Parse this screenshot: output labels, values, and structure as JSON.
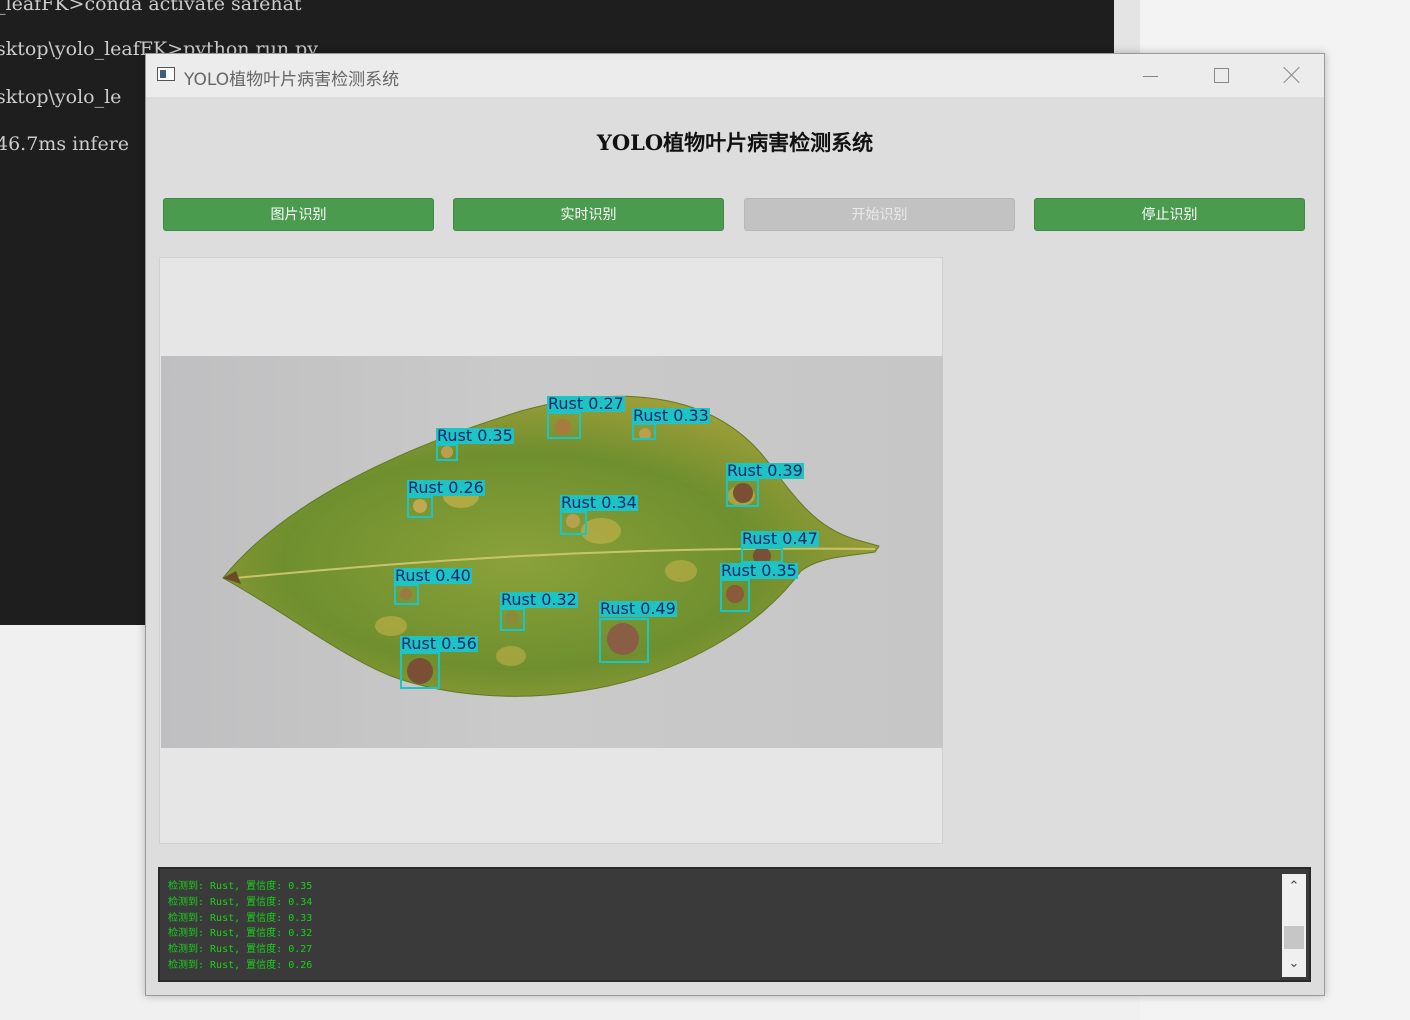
{
  "terminal": {
    "lines": [
      "_leafFK>conda activate safehat",
      "sktop\\yolo_leafFK>python run.py",
      "sktop\\yolo_le",
      "46.7ms infere"
    ]
  },
  "window": {
    "title": "YOLO植物叶片病害检测系统",
    "header": "YOLO植物叶片病害检测系统"
  },
  "toolbar": {
    "image_label": "图片识别",
    "realtime_label": "实时识别",
    "start_label": "开始识别",
    "stop_label": "停止识别"
  },
  "detections": [
    {
      "text": "Rust  0.27"
    },
    {
      "text": "Rust  0.33"
    },
    {
      "text": "Rust  0.35"
    },
    {
      "text": "Rust  0.39"
    },
    {
      "text": "Rust  0.26"
    },
    {
      "text": "Rust  0.34"
    },
    {
      "text": "Rust  0.47"
    },
    {
      "text": "Rust  0.35"
    },
    {
      "text": "Rust  0.40"
    },
    {
      "text": "Rust  0.32"
    },
    {
      "text": "Rust  0.49"
    },
    {
      "text": "Rust  0.56"
    }
  ],
  "log": {
    "lines": [
      "检测到: Rust, 置信度: 0.35",
      "检测到: Rust, 置信度: 0.34",
      "检测到: Rust, 置信度: 0.33",
      "检测到: Rust, 置信度: 0.32",
      "检测到: Rust, 置信度: 0.27",
      "检测到: Rust, 置信度: 0.26"
    ]
  },
  "colors": {
    "button_green": "#4a9b4e",
    "detection_cyan": "#1ec3c3",
    "log_text": "#19d119"
  }
}
